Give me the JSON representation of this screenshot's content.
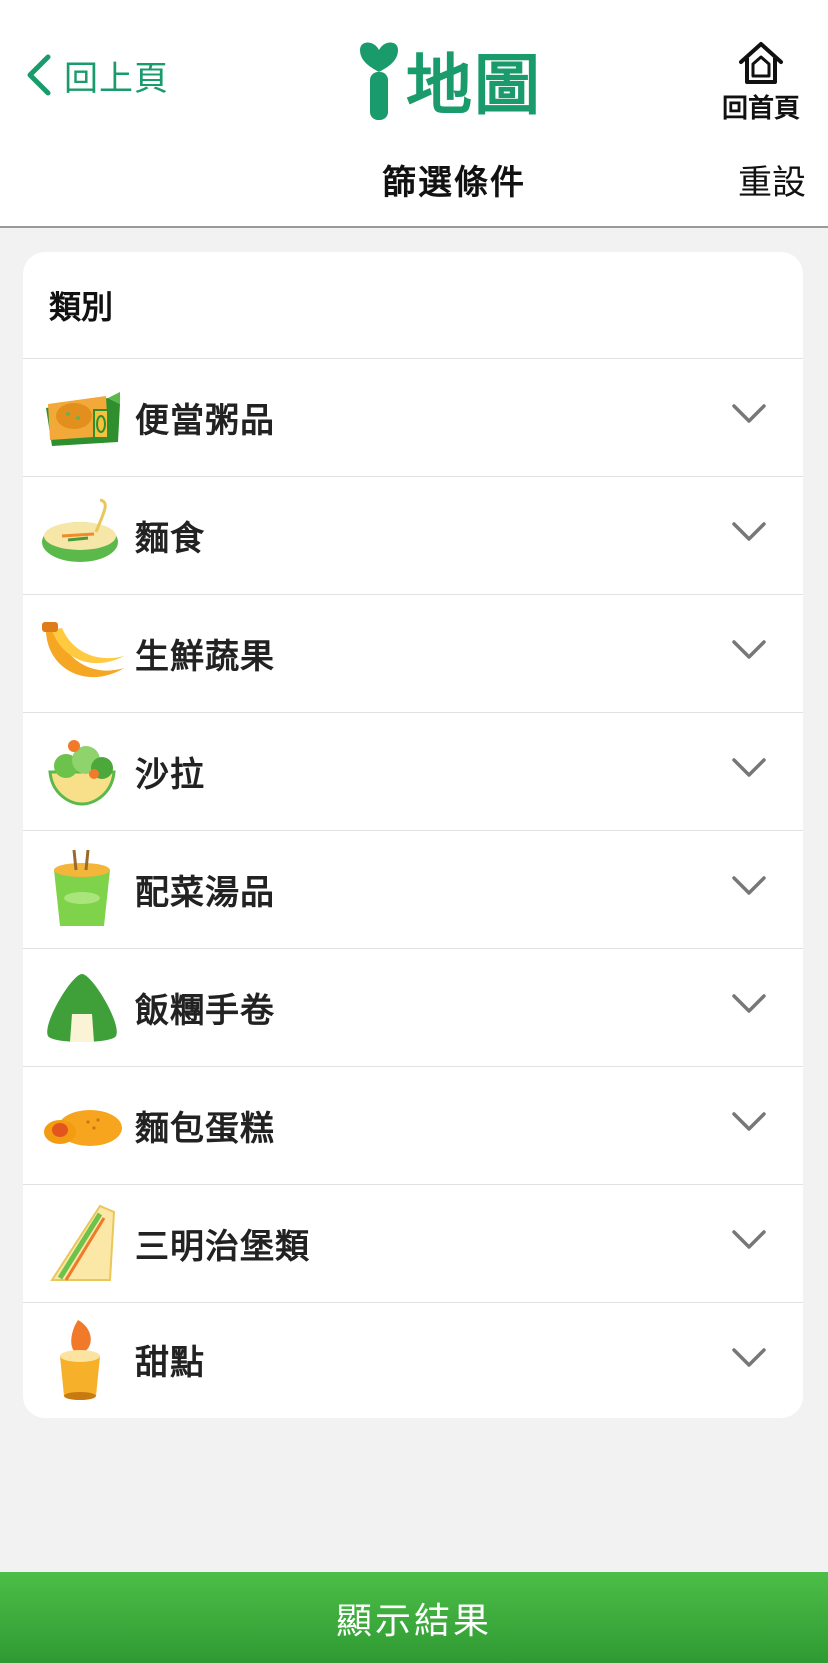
{
  "header": {
    "back_label": "回上頁",
    "logo_text": "地圖",
    "home_label": "回首頁",
    "title": "篩選條件",
    "reset_label": "重設",
    "brand_color": "#1a9b6c"
  },
  "filter": {
    "section_label": "類別",
    "categories": [
      {
        "label": "便當粥品",
        "icon": "bento-icon"
      },
      {
        "label": "麵食",
        "icon": "noodle-bowl-icon"
      },
      {
        "label": "生鮮蔬果",
        "icon": "banana-icon"
      },
      {
        "label": "沙拉",
        "icon": "salad-icon"
      },
      {
        "label": "配菜湯品",
        "icon": "soup-cup-icon"
      },
      {
        "label": "飯糰手卷",
        "icon": "rice-ball-icon"
      },
      {
        "label": "麵包蛋糕",
        "icon": "bread-icon"
      },
      {
        "label": "三明治堡類",
        "icon": "sandwich-icon"
      },
      {
        "label": "甜點",
        "icon": "pudding-icon"
      }
    ]
  },
  "footer": {
    "show_results_label": "顯示結果",
    "button_color": "#3faa3c"
  }
}
